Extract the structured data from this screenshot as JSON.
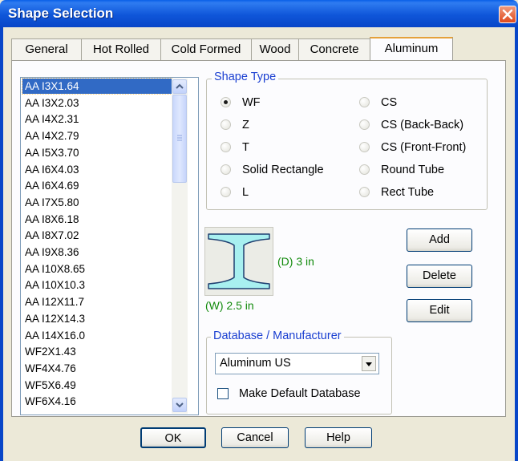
{
  "window": {
    "title": "Shape Selection"
  },
  "tabs": [
    {
      "label": "General"
    },
    {
      "label": "Hot Rolled"
    },
    {
      "label": "Cold Formed"
    },
    {
      "label": "Wood"
    },
    {
      "label": "Concrete"
    },
    {
      "label": "Aluminum",
      "active": true
    }
  ],
  "shape_list": {
    "selected": "AA I3X1.64",
    "items": [
      "AA I3X1.64",
      "AA I3X2.03",
      "AA I4X2.31",
      "AA I4X2.79",
      "AA I5X3.70",
      "AA I6X4.03",
      "AA I6X4.69",
      "AA I7X5.80",
      "AA I8X6.18",
      "AA I8X7.02",
      "AA I9X8.36",
      "AA I10X8.65",
      "AA I10X10.3",
      "AA I12X11.7",
      "AA I12X14.3",
      "AA I14X16.0",
      "WF2X1.43",
      "WF4X4.76",
      "WF5X6.49",
      "WF6X4.16"
    ]
  },
  "shape_type": {
    "legend": "Shape Type",
    "selected": "WF",
    "options_left": [
      "WF",
      "Z",
      "T",
      "Solid Rectangle",
      "L"
    ],
    "options_right": [
      "CS",
      "CS (Back-Back)",
      "CS (Front-Front)",
      "Round Tube",
      "Rect Tube"
    ]
  },
  "preview": {
    "depth_label": "(D) 3 in",
    "width_label": "(W) 2.5 in",
    "colors": {
      "section_fill": "#a8f0f0",
      "dimension_text": "#118a0b"
    }
  },
  "side_buttons": {
    "add": "Add",
    "delete": "Delete",
    "edit": "Edit"
  },
  "database": {
    "legend": "Database / Manufacturer",
    "selected": "Aluminum US",
    "default_checkbox_label": "Make Default Database",
    "default_checked": false
  },
  "footer": {
    "ok": "OK",
    "cancel": "Cancel",
    "help": "Help"
  },
  "icons": {
    "close": "close-icon",
    "dropdown": "chevron-down-icon",
    "scroll_up": "arrow-up-icon",
    "scroll_down": "arrow-down-icon"
  }
}
